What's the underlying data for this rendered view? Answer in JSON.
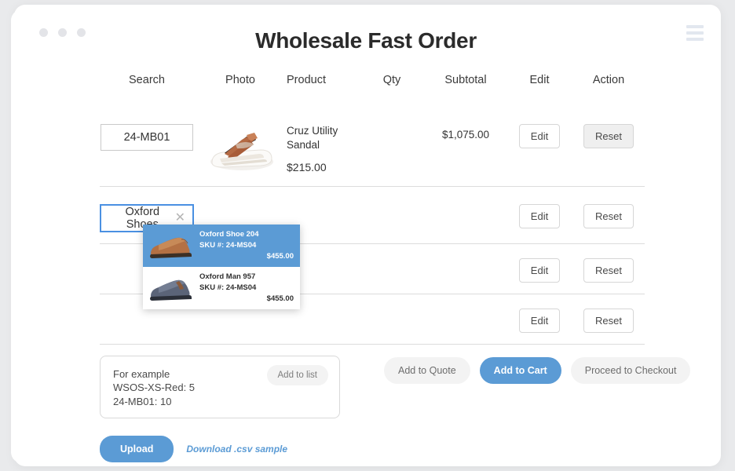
{
  "window": {
    "dots": [
      "dot",
      "dot",
      "dot"
    ],
    "menu_icon": "hamburger-menu-icon"
  },
  "header": {
    "title": "Wholesale Fast Order"
  },
  "table": {
    "columns": [
      "Search",
      "Photo",
      "Product",
      "Qty",
      "Subtotal",
      "Edit",
      "Action"
    ],
    "rows": [
      {
        "search_value": "24-MB01",
        "photo": "sandal-photo",
        "product_name": "Cruz Utility Sandal",
        "product_price": "$215.00",
        "qty": "",
        "subtotal": "$1,075.00",
        "edit_label": "Edit",
        "action_label": "Reset",
        "action_state": "active"
      },
      {
        "search_value": "Oxford Shoes",
        "clear_icon": "close-icon",
        "photo": "",
        "product_name": "",
        "product_price": "",
        "qty": "",
        "subtotal": "",
        "edit_label": "Edit",
        "action_label": "Reset",
        "action_state": "default"
      },
      {
        "search_value": "",
        "photo": "",
        "product_name": "",
        "product_price": "",
        "qty": "",
        "subtotal": "",
        "edit_label": "Edit",
        "action_label": "Reset",
        "action_state": "default"
      },
      {
        "search_value": "",
        "photo": "",
        "product_name": "",
        "product_price": "",
        "qty": "",
        "subtotal": "",
        "edit_label": "Edit",
        "action_label": "Reset",
        "action_state": "default"
      }
    ]
  },
  "autocomplete": {
    "items": [
      {
        "name": "Oxford Shoe 204",
        "sku": "SKU #: 24-MS04",
        "price": "$455.00",
        "selected": true,
        "thumb": "brown-oxford-shoe"
      },
      {
        "name": "Oxford Man 957",
        "sku": "SKU #: 24-MS04",
        "price": "$455.00",
        "selected": false,
        "thumb": "navy-oxford-shoe"
      }
    ]
  },
  "bulk": {
    "placeholder": "For example\nWSOS-XS-Red: 5\n24-MB01: 10",
    "add_to_list_label": "Add to list"
  },
  "cart_actions": {
    "add_to_quote": "Add to Quote",
    "add_to_cart": "Add to Cart",
    "proceed_to_checkout": "Proceed to Checkout"
  },
  "upload": {
    "upload_label": "Upload",
    "csv_link_label": "Download .csv sample"
  },
  "colors": {
    "accent": "#5b9bd5",
    "text": "#333333",
    "border": "#dcdcdc",
    "muted": "#6d6d6d"
  }
}
